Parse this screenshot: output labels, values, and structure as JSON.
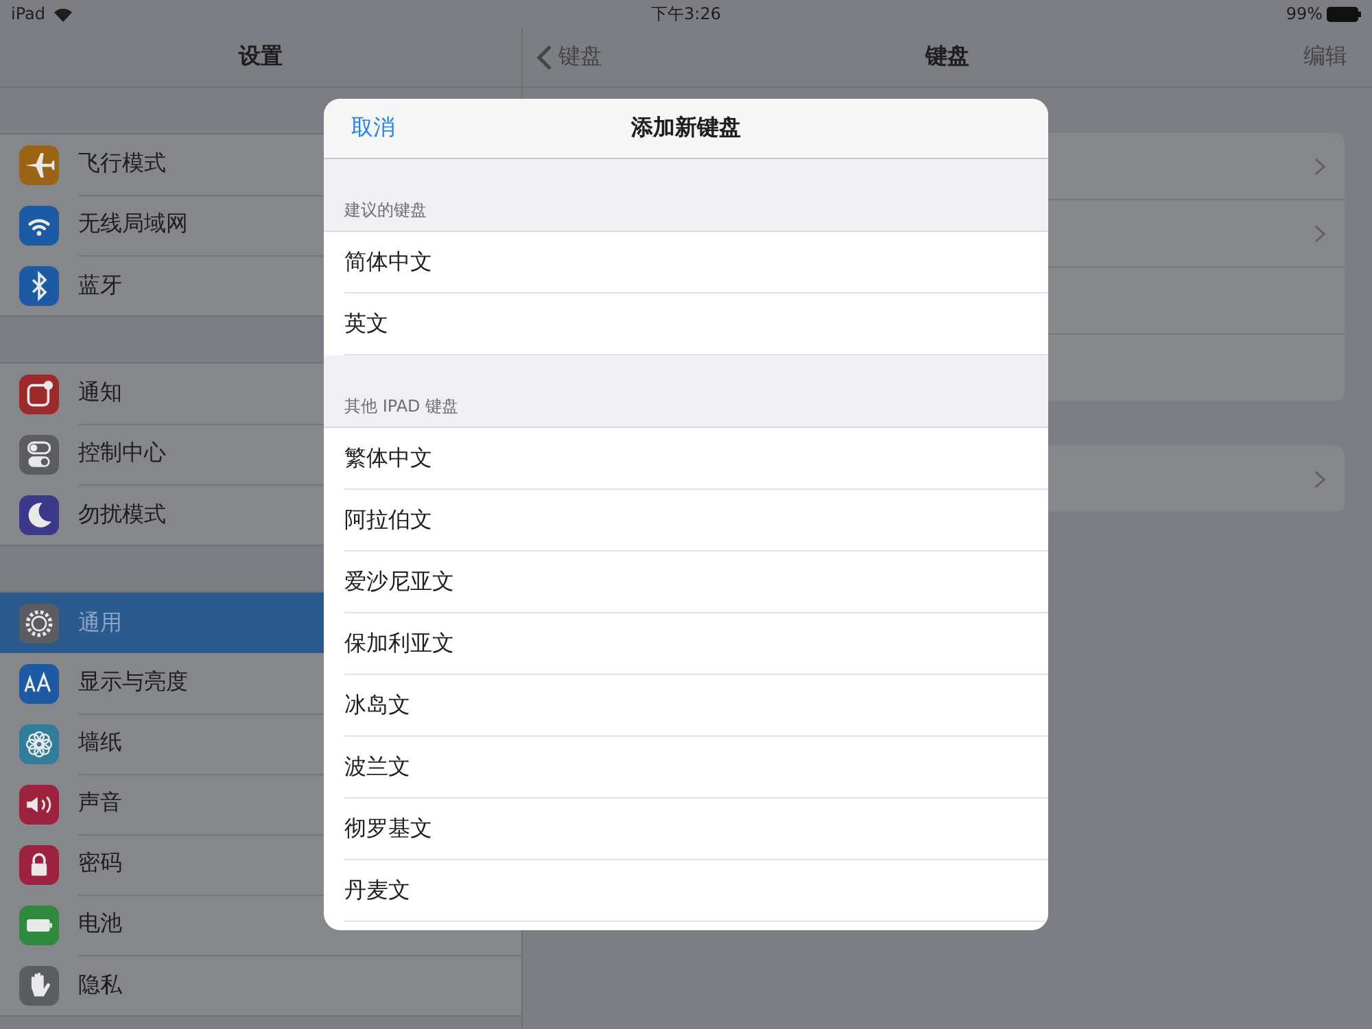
{
  "status_bar": {
    "device": "iPad",
    "time": "下午3:26",
    "battery": "99%"
  },
  "sidebar": {
    "title": "设置",
    "groups": [
      {
        "items": [
          {
            "label": "飞行模式",
            "color": "#9a6414",
            "selected": false
          },
          {
            "label": "无线局域网",
            "color": "#1d5aa4",
            "selected": false
          },
          {
            "label": "蓝牙",
            "color": "#1d5aa4",
            "selected": false
          }
        ]
      },
      {
        "items": [
          {
            "label": "通知",
            "color": "#9c2a2a",
            "selected": false
          },
          {
            "label": "控制中心",
            "color": "#5c5d62",
            "selected": false
          },
          {
            "label": "勿扰模式",
            "color": "#3b3a8a",
            "selected": false
          }
        ]
      },
      {
        "items": [
          {
            "label": "通用",
            "color": "#5c5d62",
            "selected": true
          },
          {
            "label": "显示与亮度",
            "color": "#1d5aa4",
            "selected": false
          },
          {
            "label": "墙纸",
            "color": "#2f7d9a",
            "selected": false
          },
          {
            "label": "声音",
            "color": "#9c2240",
            "selected": false
          },
          {
            "label": "密码",
            "color": "#9c2240",
            "selected": false
          },
          {
            "label": "电池",
            "color": "#2f8a3e",
            "selected": false
          },
          {
            "label": "隐私",
            "color": "#5c5d62",
            "selected": false
          }
        ]
      }
    ]
  },
  "detail": {
    "back": "键盘",
    "title": "键盘",
    "edit": "编辑",
    "groups": [
      {
        "rows": [
          {
            "chevron": true
          },
          {
            "chevron": true
          },
          {
            "chevron": false
          },
          {
            "chevron": false
          }
        ]
      },
      {
        "rows": [
          {
            "chevron": true
          }
        ]
      }
    ]
  },
  "modal": {
    "cancel": "取消",
    "title": "添加新键盘",
    "sections": [
      {
        "header": "建议的键盘",
        "items": [
          "简体中文",
          "英文"
        ]
      },
      {
        "header": "其他 IPAD 键盘",
        "items": [
          "繁体中文",
          "阿拉伯文",
          "爱沙尼亚文",
          "保加利亚文",
          "冰岛文",
          "波兰文",
          "彻罗基文",
          "丹麦文"
        ]
      }
    ]
  }
}
